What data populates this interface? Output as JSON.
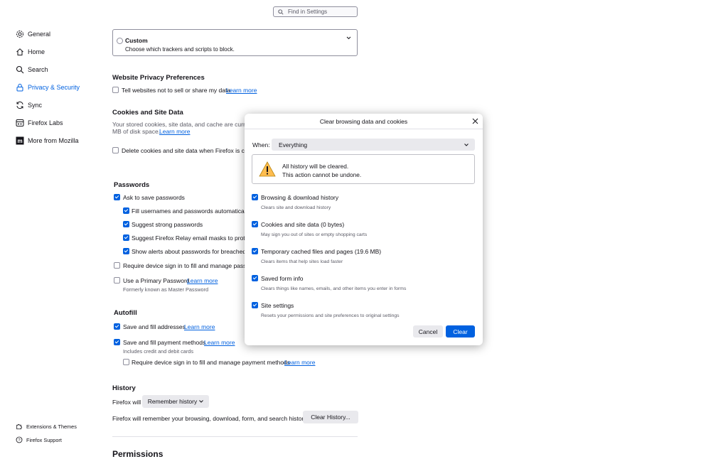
{
  "search": {
    "placeholder": "Find in Settings"
  },
  "sidebar": {
    "items": [
      {
        "label": "General",
        "icon": "gear-icon"
      },
      {
        "label": "Home",
        "icon": "home-icon"
      },
      {
        "label": "Search",
        "icon": "search-icon"
      },
      {
        "label": "Privacy & Security",
        "icon": "lock-icon",
        "active": true
      },
      {
        "label": "Sync",
        "icon": "sync-icon"
      },
      {
        "label": "Firefox Labs",
        "icon": "flask-icon"
      },
      {
        "label": "More from Mozilla",
        "icon": "mozilla-icon"
      }
    ],
    "footer": [
      {
        "label": "Extensions & Themes",
        "icon": "puzzle-icon"
      },
      {
        "label": "Firefox Support",
        "icon": "help-icon"
      }
    ]
  },
  "tracking": {
    "custom_title": "Custom",
    "custom_desc": "Choose which trackers and scripts to block."
  },
  "privacy_prefs": {
    "heading": "Website Privacy Preferences",
    "tell_sites": "Tell websites not to sell or share my data",
    "learn_more": "Learn more"
  },
  "cookies": {
    "heading": "Cookies and Site Data",
    "desc_line1": "Your stored cookies, site data, and cache are curren",
    "desc_line2": "MB of disk space.",
    "learn_more": "Learn more",
    "delete_on_close": "Delete cookies and site data when Firefox is clos"
  },
  "passwords": {
    "heading": "Passwords",
    "ask_save": "Ask to save passwords",
    "fill_auto": "Fill usernames and passwords automatically",
    "suggest_strong": "Suggest strong passwords",
    "relay": "Suggest Firefox Relay email masks to protec",
    "breach_alerts": "Show alerts about passwords for breached w",
    "device_signin": "Require device sign in to fill and manage passwo",
    "primary_pw": "Use a Primary Password",
    "learn_more": "Learn more",
    "formerly": "Formerly known as Master Password"
  },
  "autofill": {
    "heading": "Autofill",
    "addresses": "Save and fill addresses",
    "addresses_learn": "Learn more",
    "payments": "Save and fill payment methods",
    "payments_learn": "Learn more",
    "payments_sub": "Includes credit and debit cards",
    "payments_signin": "Require device sign in to fill and manage payment methods",
    "payments_signin_learn": "Learn more"
  },
  "history": {
    "heading": "History",
    "firefox_will": "Firefox will",
    "mode": "Remember history",
    "desc": "Firefox will remember your browsing, download, form, and search history.",
    "clear_button": "Clear History..."
  },
  "permissions": {
    "heading": "Permissions"
  },
  "dialog": {
    "title": "Clear browsing data and cookies",
    "when_label": "When:",
    "when_value": "Everything",
    "warning_line1": "All history will be cleared.",
    "warning_line2": "This action cannot be undone.",
    "options": [
      {
        "label": "Browsing & download history",
        "sub": "Clears site and download history",
        "checked": true
      },
      {
        "label": "Cookies and site data (0 bytes)",
        "sub": "May sign you out of sites or empty shopping carts",
        "checked": true
      },
      {
        "label": "Temporary cached files and pages (19.6 MB)",
        "sub": "Clears items that help sites load faster",
        "checked": true
      },
      {
        "label": "Saved form info",
        "sub": "Clears things like names, emails, and other items you enter in forms",
        "checked": true
      },
      {
        "label": "Site settings",
        "sub": "Resets your permissions and site preferences to original settings",
        "checked": true
      }
    ],
    "cancel": "Cancel",
    "clear": "Clear"
  }
}
